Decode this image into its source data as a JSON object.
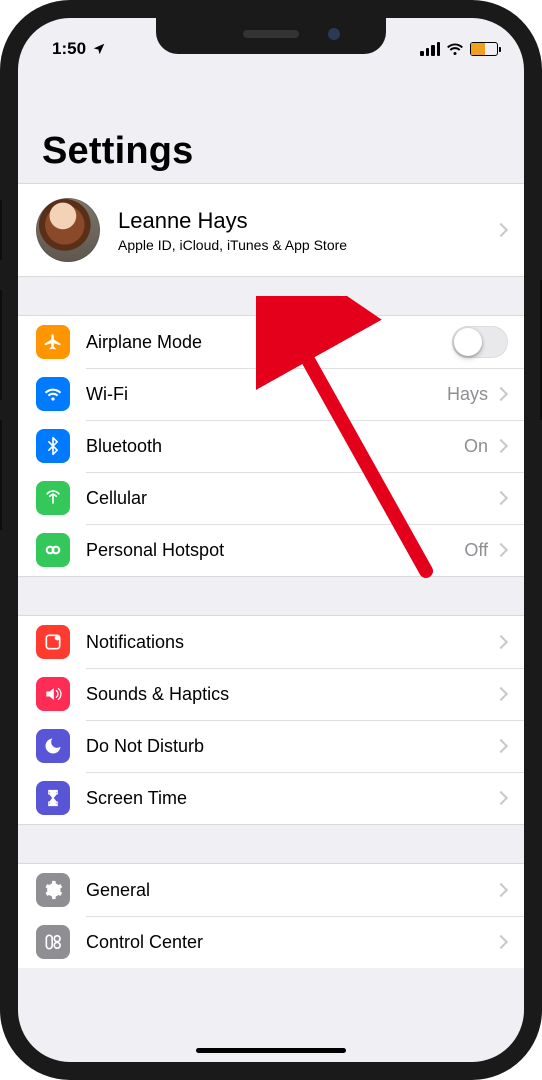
{
  "statusbar": {
    "time": "1:50"
  },
  "title": "Settings",
  "profile": {
    "name": "Leanne Hays",
    "subtitle": "Apple ID, iCloud, iTunes & App Store"
  },
  "group1": {
    "airplane": {
      "label": "Airplane Mode"
    },
    "wifi": {
      "label": "Wi-Fi",
      "value": "Hays"
    },
    "bluetooth": {
      "label": "Bluetooth",
      "value": "On"
    },
    "cellular": {
      "label": "Cellular"
    },
    "hotspot": {
      "label": "Personal Hotspot",
      "value": "Off"
    }
  },
  "group2": {
    "notifications": {
      "label": "Notifications"
    },
    "sounds": {
      "label": "Sounds & Haptics"
    },
    "dnd": {
      "label": "Do Not Disturb"
    },
    "screentime": {
      "label": "Screen Time"
    }
  },
  "group3": {
    "general": {
      "label": "General"
    },
    "controlcenter": {
      "label": "Control Center"
    }
  }
}
